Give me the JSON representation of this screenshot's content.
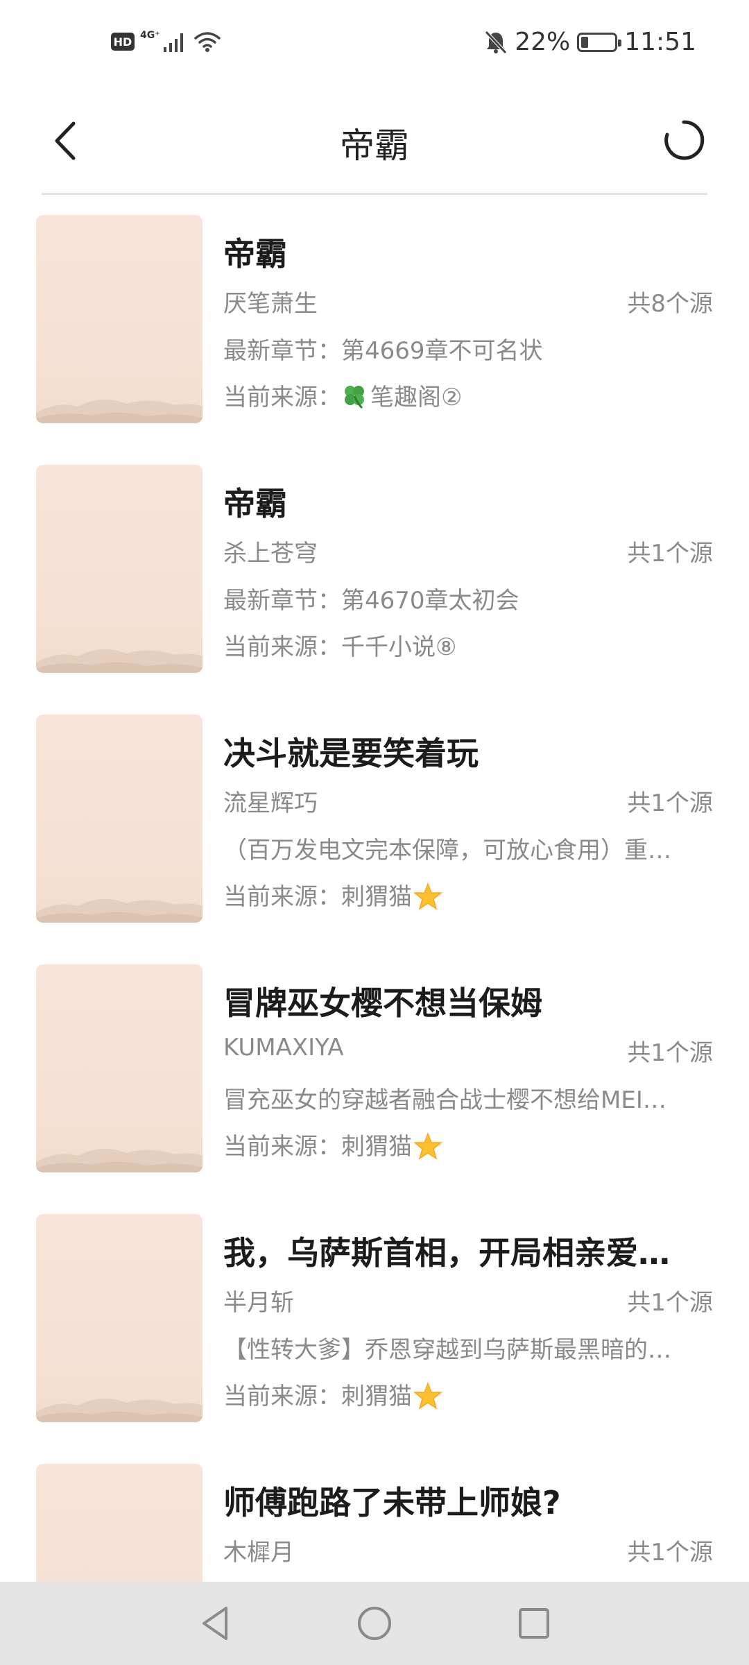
{
  "status_bar": {
    "hd_label": "HD",
    "network_label": "4G⁺",
    "battery_percent": "22%",
    "battery_level": 0.22,
    "time": "11:51"
  },
  "header": {
    "title": "帝霸",
    "back_icon": "chevron-left-icon",
    "refresh_icon": "refresh-icon"
  },
  "books": [
    {
      "title": "帝霸",
      "author": "厌笔萧生",
      "sources": "共8个源",
      "line3": "最新章节：第4669章不可名状",
      "source_prefix": "当前来源：",
      "source_name": "笔趣阁②",
      "source_icon": "clover-icon"
    },
    {
      "title": "帝霸",
      "author": "杀上苍穹",
      "sources": "共1个源",
      "line3": "最新章节：第4670章太初会",
      "source_prefix": "当前来源：",
      "source_name": "千千小说⑧",
      "source_icon": ""
    },
    {
      "title": "决斗就是要笑着玩",
      "author": "流星辉巧",
      "sources": "共1个源",
      "line3": "（百万发电文完本保障，可放心食用）重…",
      "source_prefix": "当前来源：",
      "source_name": "刺猬猫",
      "source_icon": "star-icon"
    },
    {
      "title": "冒牌巫女樱不想当保姆",
      "author": "KUMAXIYA",
      "sources": "共1个源",
      "line3": "冒充巫女的穿越者融合战士樱不想给MEI…",
      "source_prefix": "当前来源：",
      "source_name": "刺猬猫",
      "source_icon": "star-icon"
    },
    {
      "title": "我，乌萨斯首相，开局相亲爱…",
      "author": "半月斩",
      "sources": "共1个源",
      "line3": "【性转大爹】乔恩穿越到乌萨斯最黑暗的…",
      "source_prefix": "当前来源：",
      "source_name": "刺猬猫",
      "source_icon": "star-icon"
    },
    {
      "title": "师傅跑路了未带上师娘?",
      "author": "木樨月",
      "sources": "共1个源",
      "line3": "",
      "source_prefix": "",
      "source_name": "",
      "source_icon": ""
    }
  ],
  "nav_bar": {
    "back_icon": "triangle-back-icon",
    "home_icon": "circle-home-icon",
    "recents_icon": "square-recents-icon"
  },
  "colors": {
    "cover_bg": "#f6e1d4",
    "secondary_text": "#8a8a8a",
    "title_text": "#1c1c1c",
    "nav_bar_bg": "#e4e4e4"
  }
}
